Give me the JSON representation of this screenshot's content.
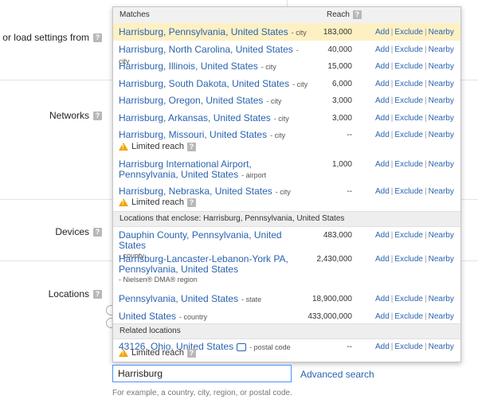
{
  "left_panel": {
    "load_settings_label": "or load settings from",
    "networks_label": "Networks",
    "devices_label": "Devices",
    "locations_label": "Locations",
    "help_icon_glyph": "?"
  },
  "dropdown": {
    "matches_header": "Matches",
    "reach_header": "Reach",
    "action_add": "Add",
    "action_exclude": "Exclude",
    "action_nearby": "Nearby",
    "separator": "|",
    "limited_reach": "Limited reach",
    "matches": [
      {
        "name": "Harrisburg, Pennsylvania, United States",
        "type": "- city",
        "reach": "183,000",
        "highlighted": true
      },
      {
        "name": "Harrisburg, North Carolina, United States",
        "type": "- city",
        "reach": "40,000"
      },
      {
        "name": "Harrisburg, Illinois, United States",
        "type": "- city",
        "reach": "15,000"
      },
      {
        "name": "Harrisburg, South Dakota, United States",
        "type": "- city",
        "reach": "6,000"
      },
      {
        "name": "Harrisburg, Oregon, United States",
        "type": "- city",
        "reach": "3,000"
      },
      {
        "name": "Harrisburg, Arkansas, United States",
        "type": "- city",
        "reach": "3,000"
      },
      {
        "name": "Harrisburg, Missouri, United States",
        "type": "- city",
        "reach": "--",
        "limited": true
      },
      {
        "name": "Harrisburg International Airport, Pennsylvania, United States",
        "type": "- airport",
        "reach": "1,000"
      },
      {
        "name": "Harrisburg, Nebraska, United States",
        "type": "- city",
        "reach": "--",
        "limited": true
      }
    ],
    "enclose_header": "Locations that enclose: Harrisburg, Pennsylvania, United States",
    "enclosing": [
      {
        "name": "Dauphin County, Pennsylvania, United States",
        "type": "- county",
        "reach": "483,000"
      },
      {
        "name": "Harrisburg-Lancaster-Lebanon-York PA, Pennsylvania, United States",
        "type": "- Nielsen® DMA® region",
        "reach": "2,430,000"
      },
      {
        "name": "Pennsylvania, United States",
        "type": "- state",
        "reach": "18,900,000"
      },
      {
        "name": "United States",
        "type": "- country",
        "reach": "433,000,000"
      }
    ],
    "related_header": "Related locations",
    "related": [
      {
        "name": "43126, Ohio, United States",
        "type": "- postal code",
        "reach": "--",
        "limited": true
      }
    ]
  },
  "search": {
    "value": "Harrisburg",
    "advanced_link": "Advanced search",
    "example_text": "For example, a country, city, region, or postal code."
  },
  "colors": {
    "link_blue": "#2a63b0",
    "highlight": "#fdf1c4",
    "warning": "#f0a500"
  }
}
